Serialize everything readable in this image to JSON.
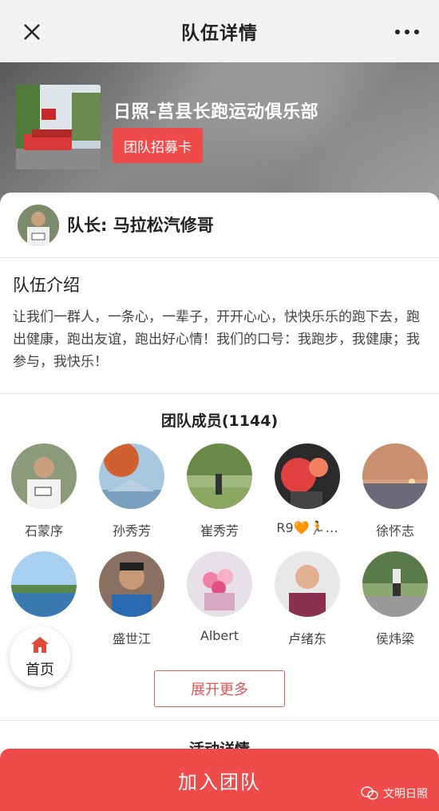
{
  "nav": {
    "title": "队伍详情",
    "close_icon": "close-icon",
    "more_icon": "more-icon"
  },
  "hero": {
    "team_name": "日照-莒县长跑运动俱乐部",
    "recruit_button": "团队招募卡"
  },
  "captain": {
    "label": "队长: 马拉松汽修哥"
  },
  "intro": {
    "title": "队伍介绍",
    "text": "让我们一群人，一条心，一辈子，开开心心，快快乐乐的跑下去，跑出健康，跑出友谊，跑出好心情！我们的口号：我跑步，我健康；我参与，我快乐！"
  },
  "members": {
    "title": "团队成员(1144)",
    "list": [
      {
        "name": "石蒙序",
        "color": "#8a9a7a"
      },
      {
        "name": "孙秀芳",
        "color": "#d06030"
      },
      {
        "name": "崔秀芳",
        "color": "#6a8a4a"
      },
      {
        "name": "R9🧡🏃…",
        "color": "#c04040"
      },
      {
        "name": "徐怀志",
        "color": "#c89070"
      },
      {
        "name": "",
        "color": "#4a8ab0"
      },
      {
        "name": "盛世江",
        "color": "#8a7060"
      },
      {
        "name": "Albert",
        "color": "#d8a8c0"
      },
      {
        "name": "卢绪东",
        "color": "#b0b0b0"
      },
      {
        "name": "侯炜梁",
        "color": "#6a8a5a"
      }
    ]
  },
  "more_button": "展开更多",
  "activity": {
    "title": "活动详情"
  },
  "home_fab": {
    "label": "首页"
  },
  "join": {
    "label": "加入团队"
  },
  "watermark": {
    "text": "文明日照"
  },
  "colors": {
    "accent": "#f04b4b",
    "nav_bg": "#f2f2f2"
  }
}
